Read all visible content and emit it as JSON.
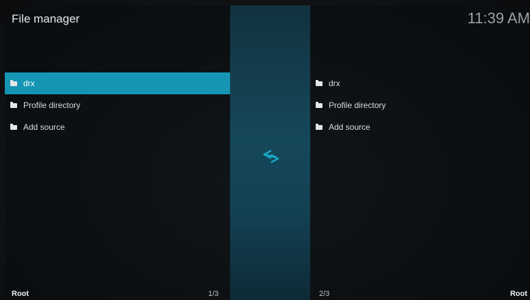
{
  "header": {
    "title": "File manager",
    "clock": "11:39 AM"
  },
  "left_panel": {
    "items": [
      {
        "label": "drx",
        "icon": "folder-icon",
        "focused": true
      },
      {
        "label": "Profile directory",
        "icon": "folder-icon",
        "focused": false
      },
      {
        "label": "Add source",
        "icon": "folder-icon",
        "focused": false
      }
    ],
    "footer_label": "Root",
    "footer_count": "1/3"
  },
  "right_panel": {
    "items": [
      {
        "label": "drx",
        "icon": "folder-icon"
      },
      {
        "label": "Profile directory",
        "icon": "folder-icon"
      },
      {
        "label": "Add source",
        "icon": "folder-icon"
      }
    ],
    "footer_label": "Root",
    "footer_count": "2/3"
  },
  "center": {
    "icon": "swap-arrows-icon"
  },
  "colors": {
    "accent": "#1595b3",
    "center_strip": "#15475a"
  }
}
